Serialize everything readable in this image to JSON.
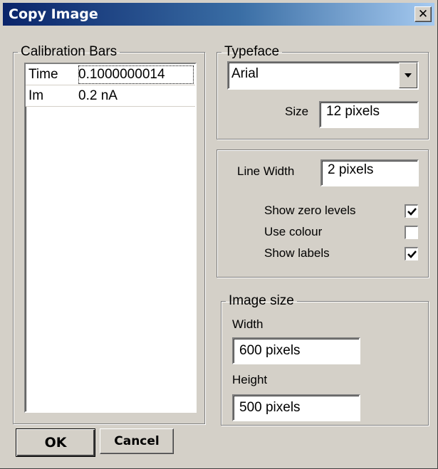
{
  "window": {
    "title": "Copy Image",
    "close_glyph": "✕"
  },
  "calibration": {
    "legend": "Calibration Bars",
    "rows": [
      {
        "name": "Time",
        "value": "0.1000000014"
      },
      {
        "name": "Im",
        "value": "0.2 nA"
      }
    ]
  },
  "typeface": {
    "legend": "Typeface",
    "font_value": "Arial",
    "size_label": "Size",
    "size_value": "12  pixels"
  },
  "display": {
    "line_width_label": "Line Width",
    "line_width_value": "2  pixels",
    "options": [
      {
        "label": "Show zero levels",
        "checked": true
      },
      {
        "label": "Use colour",
        "checked": false
      },
      {
        "label": "Show labels",
        "checked": true
      }
    ]
  },
  "image_size": {
    "legend": "Image size",
    "width_label": "Width",
    "width_value": "600  pixels",
    "height_label": "Height",
    "height_value": "500 pixels"
  },
  "buttons": {
    "ok": "OK",
    "cancel": "Cancel"
  },
  "icons": {
    "close": "close-icon",
    "dropdown": "chevron-down-icon",
    "check": "checkmark-icon"
  }
}
